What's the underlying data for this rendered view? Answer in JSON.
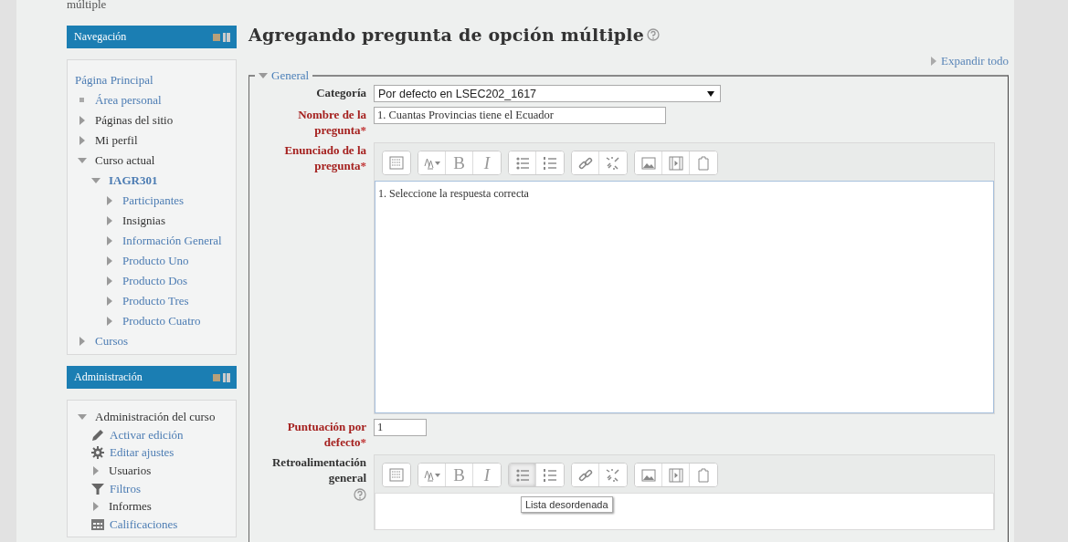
{
  "breadcrumb_tail": "múltiple",
  "navigation": {
    "title": "Navegación",
    "items": [
      {
        "label": "Página Principal",
        "kind": "none",
        "link": true,
        "bold": false
      },
      {
        "label": "Área personal",
        "kind": "bullet",
        "link": true,
        "bold": false
      },
      {
        "label": "Páginas del sitio",
        "kind": "collapsed",
        "link": false,
        "bold": false
      },
      {
        "label": "Mi perfil",
        "kind": "collapsed",
        "link": false,
        "bold": false
      },
      {
        "label": "Curso actual",
        "kind": "expanded",
        "link": false,
        "bold": false,
        "children": [
          {
            "label": "IAGR301",
            "kind": "expanded",
            "link": true,
            "bold": true,
            "children": [
              {
                "label": "Participantes",
                "kind": "collapsed",
                "link": true,
                "bold": false
              },
              {
                "label": "Insignias",
                "kind": "collapsed",
                "link": false,
                "bold": false
              },
              {
                "label": "Información General",
                "kind": "collapsed",
                "link": true,
                "bold": false
              },
              {
                "label": "Producto Uno",
                "kind": "collapsed",
                "link": true,
                "bold": false
              },
              {
                "label": "Producto Dos",
                "kind": "collapsed",
                "link": true,
                "bold": false
              },
              {
                "label": "Producto Tres",
                "kind": "collapsed",
                "link": true,
                "bold": false
              },
              {
                "label": "Producto Cuatro",
                "kind": "collapsed",
                "link": true,
                "bold": false
              }
            ]
          }
        ]
      },
      {
        "label": "Cursos",
        "kind": "collapsed",
        "link": true,
        "bold": false
      }
    ]
  },
  "administration": {
    "title": "Administración",
    "items": [
      {
        "label": "Administración del curso",
        "kind": "expanded",
        "link": false,
        "bold": false,
        "children": [
          {
            "label": "Activar edición",
            "kind": "pencil",
            "link": true,
            "bold": false
          },
          {
            "label": "Editar ajustes",
            "kind": "gear",
            "link": true,
            "bold": false
          },
          {
            "label": "Usuarios",
            "kind": "collapsed",
            "link": false,
            "bold": false
          },
          {
            "label": "Filtros",
            "kind": "filter",
            "link": true,
            "bold": false
          },
          {
            "label": "Informes",
            "kind": "collapsed",
            "link": false,
            "bold": false
          },
          {
            "label": "Calificaciones",
            "kind": "grid",
            "link": true,
            "bold": false
          }
        ]
      }
    ]
  },
  "page_title": "Agregando pregunta de opción múltiple",
  "expand_all": "Expandir todo",
  "section": {
    "legend": "General",
    "expanded": true
  },
  "fields": [
    {
      "kind": "select",
      "label": "Categoría",
      "required": false,
      "help": false,
      "value": "Por defecto en LSEC202_1617"
    },
    {
      "kind": "text",
      "label": "Nombre de la pregunta",
      "required": true,
      "help": false,
      "value": "1. Cuantas Provincias tiene el Ecuador"
    },
    {
      "kind": "editor",
      "label": "Enunciado de la pregunta",
      "required": true,
      "help": false,
      "value": "1. Seleccione la respuesta correcta",
      "toolbar": [
        {
          "kind": "toggle",
          "selected": false
        },
        {
          "kind": "fontsize",
          "selected": false
        },
        {
          "kind": "bold",
          "selected": false,
          "label": "B"
        },
        {
          "kind": "italic",
          "selected": false,
          "label": "I"
        },
        {
          "kind": "ul",
          "selected": false
        },
        {
          "kind": "ol",
          "selected": false
        },
        {
          "kind": "link",
          "selected": false
        },
        {
          "kind": "unlink",
          "selected": false
        },
        {
          "kind": "image",
          "selected": false
        },
        {
          "kind": "media",
          "selected": false
        },
        {
          "kind": "paste",
          "selected": false
        }
      ]
    },
    {
      "kind": "number",
      "label": "Puntuación por defecto",
      "required": true,
      "help": false,
      "value": "1"
    },
    {
      "kind": "editor",
      "label": "Retroalimentación general",
      "required": false,
      "help": true,
      "tooltip": "Lista desordenada",
      "toolbar": [
        {
          "kind": "toggle",
          "selected": false
        },
        {
          "kind": "fontsize",
          "selected": false
        },
        {
          "kind": "bold",
          "selected": false,
          "label": "B"
        },
        {
          "kind": "italic",
          "selected": false,
          "label": "I"
        },
        {
          "kind": "ul",
          "selected": true
        },
        {
          "kind": "ol",
          "selected": false
        },
        {
          "kind": "link",
          "selected": false
        },
        {
          "kind": "unlink",
          "selected": false
        },
        {
          "kind": "image",
          "selected": false
        },
        {
          "kind": "media",
          "selected": false
        },
        {
          "kind": "paste",
          "selected": false
        }
      ]
    }
  ],
  "required_mark": "*"
}
